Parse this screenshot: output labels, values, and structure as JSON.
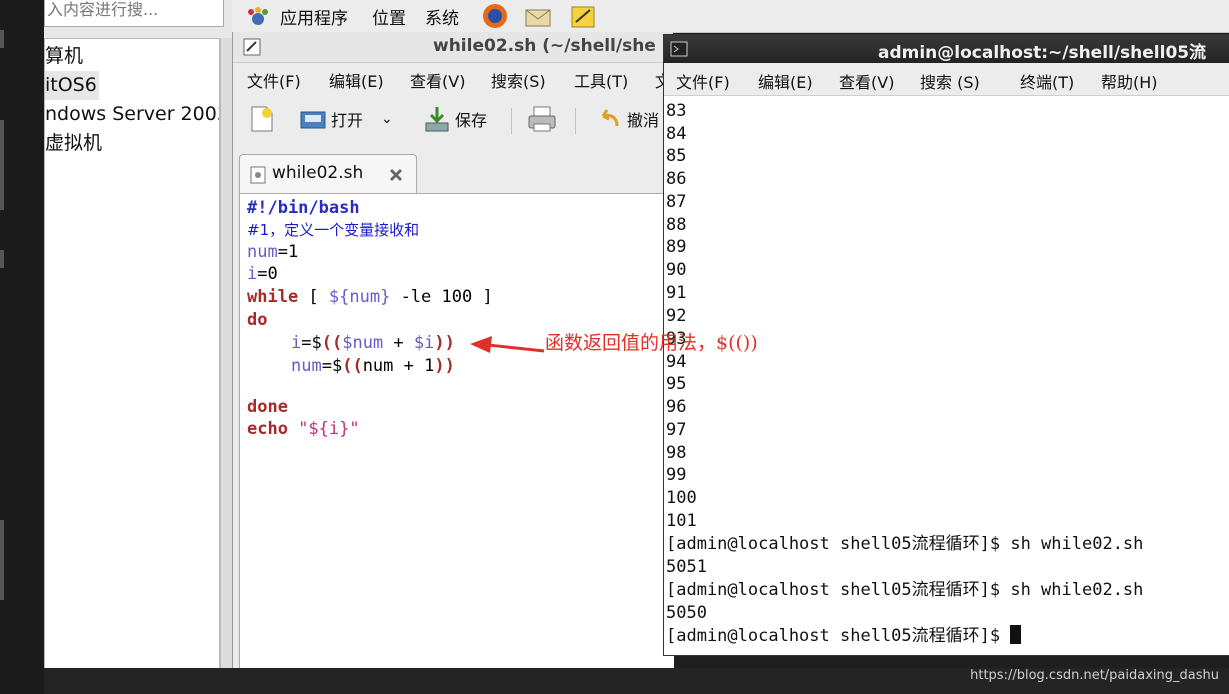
{
  "vm_panel": {
    "search_text": "入内容进行搜...",
    "items": [
      "算机",
      "itOS6",
      "ndows Server 2003",
      "虚拟机"
    ]
  },
  "gnome_panel": {
    "applications": "应用程序",
    "places": "位置",
    "system": "系统"
  },
  "gedit": {
    "title": "while02.sh (~/shell/she",
    "menu": [
      "文件(F)",
      "编辑(E)",
      "查看(V)",
      "搜索(S)",
      "工具(T)",
      "文"
    ],
    "toolbar": {
      "open": "打开",
      "save": "保存",
      "undo": "撤消"
    },
    "tab_name": "while02.sh",
    "code": {
      "shebang": "#!/bin/bash",
      "comment": "#1，定义一个变量接收和",
      "l3_var": "num",
      "l3_rest": "=1",
      "l4_var": "i",
      "l4_rest": "=0",
      "l5_kw": "while",
      "l5_a": " [ ",
      "l5_var": "${num}",
      "l5_b": " -le 100 ]",
      "l6_kw": "do",
      "l7_var": "i",
      "l7_a": "=$",
      "l7_b": "((",
      "l7_v1": "$num",
      "l7_c": " + ",
      "l7_v2": "$i",
      "l7_d": "))",
      "l8_var": "num",
      "l8_a": "=$",
      "l8_b": "((",
      "l8_c": "num + 1",
      "l8_d": "))",
      "l10_kw": "done",
      "l11_kw": "echo",
      "l11_str": " \"${i}\""
    }
  },
  "annotation": "函数返回值的用法，$(())",
  "terminal": {
    "title": "admin@localhost:~/shell/shell05流",
    "menu": [
      "文件(F)",
      "编辑(E)",
      "查看(V)",
      "搜索 (S)",
      "终端(T)",
      "帮助(H)"
    ],
    "lines": [
      "83",
      "84",
      "85",
      "86",
      "87",
      "88",
      "89",
      "90",
      "91",
      "92",
      "93",
      "94",
      "95",
      "96",
      "97",
      "98",
      "99",
      "100",
      "101",
      "[admin@localhost shell05流程循环]$ sh while02.sh",
      "5051",
      "[admin@localhost shell05流程循环]$ sh while02.sh",
      "5050",
      "[admin@localhost shell05流程循环]$ "
    ]
  },
  "watermark": "https://blog.csdn.net/paidaxing_dashu"
}
